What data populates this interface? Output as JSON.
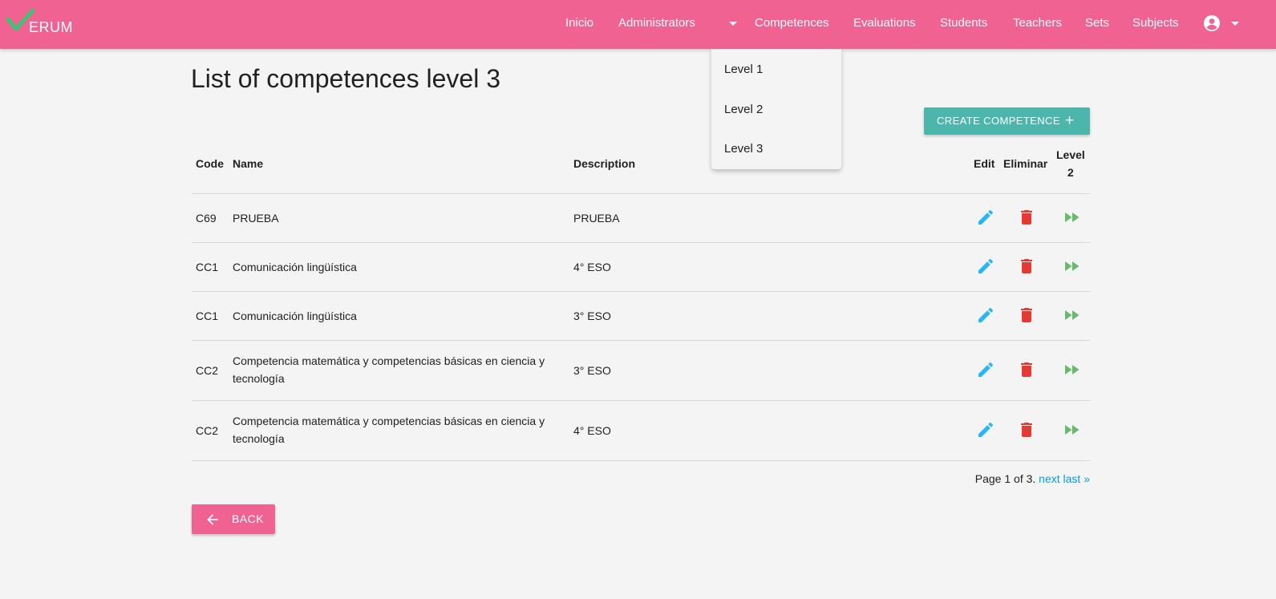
{
  "brand": {
    "logo_text": "ERUM",
    "color": "#f06292"
  },
  "nav": {
    "items": [
      {
        "label": "Inicio"
      },
      {
        "label": "Administrators"
      },
      {
        "label": "Competences"
      },
      {
        "label": "Evaluations"
      },
      {
        "label": "Students"
      },
      {
        "label": "Teachers"
      },
      {
        "label": "Sets"
      },
      {
        "label": "Subjects"
      }
    ],
    "account_icon": "account-circle-icon"
  },
  "dropdown": {
    "items": [
      {
        "label": "Level 1"
      },
      {
        "label": "Level 2"
      },
      {
        "label": "Level 3"
      }
    ]
  },
  "page": {
    "title": "List of competences level 3",
    "create_label": "CREATE COMPETENCE",
    "create_icon": "plus-icon",
    "accent": "#4db6ac"
  },
  "table": {
    "headers": {
      "code": "Code",
      "name": "Name",
      "description": "Description",
      "edit": "Edit",
      "delete": "Eliminar",
      "level_line1": "Level",
      "level_line2": "2"
    },
    "rows": [
      {
        "code": "C69",
        "name": "PRUEBA",
        "description": "PRUEBA"
      },
      {
        "code": "CC1",
        "name": "Comunicación lingüística",
        "description": "4° ESO"
      },
      {
        "code": "CC1",
        "name": "Comunicación lingüística",
        "description": "3° ESO"
      },
      {
        "code": "CC2",
        "name": "Competencia matemática y competencias básicas en ciencia y tecnología",
        "description": "3° ESO"
      },
      {
        "code": "CC2",
        "name": "Competencia matemática y competencias básicas en ciencia y tecnología",
        "description": "4° ESO"
      }
    ],
    "icon_colors": {
      "edit": "#29b6f6",
      "delete": "#e53935",
      "level": "#66bb6a"
    }
  },
  "pagination": {
    "text": "Page 1 of 3.",
    "next": "next",
    "last": "last »"
  },
  "back": {
    "label": "BACK",
    "icon": "arrow-left-icon"
  }
}
